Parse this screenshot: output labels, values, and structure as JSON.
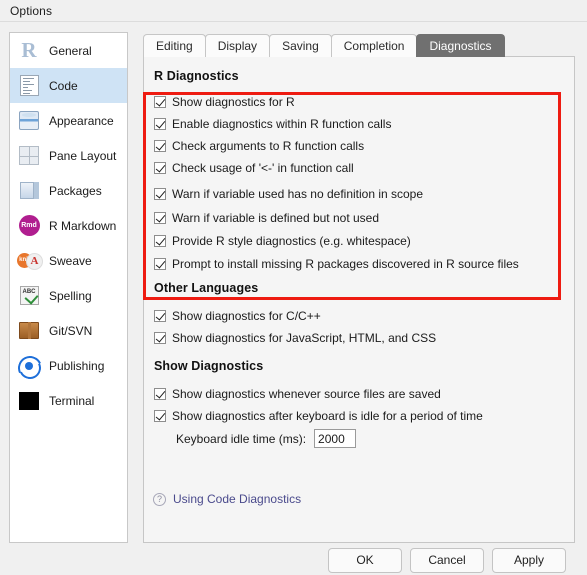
{
  "window": {
    "title": "Options"
  },
  "sidebar": {
    "items": [
      {
        "label": "General",
        "icon": "r-logo-icon",
        "selected": false
      },
      {
        "label": "Code",
        "icon": "code-document-icon",
        "selected": true
      },
      {
        "label": "Appearance",
        "icon": "paint-can-icon",
        "selected": false
      },
      {
        "label": "Pane Layout",
        "icon": "pane-grid-icon",
        "selected": false
      },
      {
        "label": "Packages",
        "icon": "package-box-icon",
        "selected": false
      },
      {
        "label": "R Markdown",
        "icon": "rmd-badge-icon",
        "selected": false
      },
      {
        "label": "Sweave",
        "icon": "knit-pdf-icon",
        "selected": false
      },
      {
        "label": "Spelling",
        "icon": "abc-check-icon",
        "selected": false
      },
      {
        "label": "Git/SVN",
        "icon": "brown-box-icon",
        "selected": false
      },
      {
        "label": "Publishing",
        "icon": "publish-orbit-icon",
        "selected": false
      },
      {
        "label": "Terminal",
        "icon": "black-square-icon",
        "selected": false
      }
    ]
  },
  "tabs": [
    {
      "label": "Editing",
      "active": false
    },
    {
      "label": "Display",
      "active": false
    },
    {
      "label": "Saving",
      "active": false
    },
    {
      "label": "Completion",
      "active": false
    },
    {
      "label": "Diagnostics",
      "active": true
    }
  ],
  "highlight": {
    "color": "#ee1b11",
    "target": "r-diagnostics-section"
  },
  "sections": {
    "r_diagnostics": {
      "heading": "R Diagnostics",
      "options": [
        {
          "label": "Show diagnostics for R",
          "checked": true
        },
        {
          "label": "Enable diagnostics within R function calls",
          "checked": true
        },
        {
          "label": "Check arguments to R function calls",
          "checked": true
        },
        {
          "label": "Check usage of '<-' in function call",
          "checked": true
        },
        {
          "label": "Warn if variable used has no definition in scope",
          "checked": true
        },
        {
          "label": "Warn if variable is defined but not used",
          "checked": true
        },
        {
          "label": "Provide R style diagnostics (e.g. whitespace)",
          "checked": true
        },
        {
          "label": "Prompt to install missing R packages discovered in R source files",
          "checked": true
        }
      ]
    },
    "other_languages": {
      "heading": "Other Languages",
      "options": [
        {
          "label": "Show diagnostics for C/C++",
          "checked": true
        },
        {
          "label": "Show diagnostics for JavaScript, HTML, and CSS",
          "checked": true
        }
      ]
    },
    "show_diagnostics": {
      "heading": "Show Diagnostics",
      "options": [
        {
          "label": "Show diagnostics whenever source files are saved",
          "checked": true
        },
        {
          "label": "Show diagnostics after keyboard is idle for a period of time",
          "checked": true
        }
      ],
      "idle_time": {
        "label": "Keyboard idle time (ms):",
        "value": "2000"
      }
    }
  },
  "help": {
    "icon": "question-mark-icon",
    "link_label": "Using Code Diagnostics",
    "link_color": "#4a4a8c"
  },
  "footer": {
    "ok_label": "OK",
    "cancel_label": "Cancel",
    "apply_label": "Apply"
  }
}
